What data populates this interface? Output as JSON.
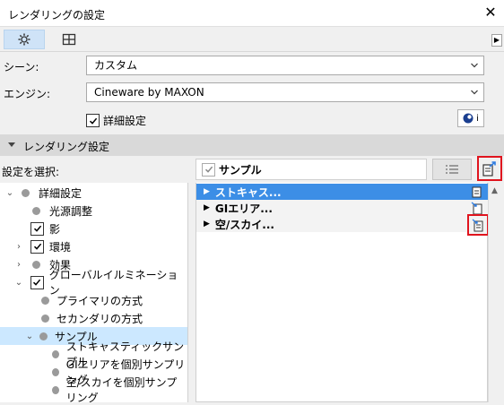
{
  "window": {
    "title": "レンダリングの設定",
    "close": "✕"
  },
  "tabs": [
    {
      "name": "settings",
      "icon": "gear-icon"
    },
    {
      "name": "layout",
      "icon": "grid-icon"
    }
  ],
  "scene": {
    "label": "シーン:",
    "value": "カスタム"
  },
  "engine": {
    "label": "エンジン:",
    "value": "Cineware by MAXON"
  },
  "detail": {
    "label": "詳細設定",
    "checked": true,
    "info_text": "i"
  },
  "section": {
    "title": "レンダリング設定"
  },
  "select_label": "設定を選択:",
  "right_header": {
    "label": "サンプル"
  },
  "tree": [
    {
      "label": "詳細設定"
    },
    {
      "label": "光源調整"
    },
    {
      "label": "影"
    },
    {
      "label": "環境"
    },
    {
      "label": "効果"
    },
    {
      "label": "グローバルイルミネーション"
    },
    {
      "label": "プライマリの方式"
    },
    {
      "label": "セカンダリの方式"
    },
    {
      "label": "サンプル"
    },
    {
      "label": "ストキャスティックサンプル"
    },
    {
      "label": "GIエリアを個別サンプリング"
    },
    {
      "label": "空/スカイを個別サンプリング"
    }
  ],
  "right_rows": [
    {
      "label": "ストキャス..."
    },
    {
      "label": "GIエリア..."
    },
    {
      "label": "空/スカイ..."
    }
  ],
  "colors": {
    "accent": "#3c8ee6",
    "selected_row": "#cce8ff",
    "red_box": "#e0141e"
  }
}
